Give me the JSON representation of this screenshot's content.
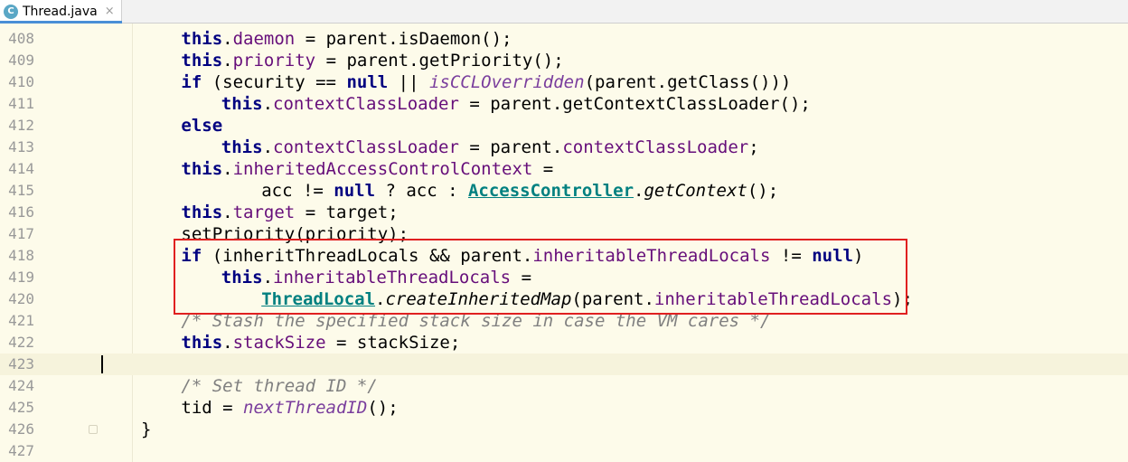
{
  "tab": {
    "icon_letter": "C",
    "title": "Thread.java",
    "close_glyph": "×"
  },
  "lines": [
    {
      "num": "408",
      "indent": 4,
      "tokens": [
        [
          "kw",
          "this"
        ],
        [
          "",
          "."
        ],
        [
          "fld",
          "daemon"
        ],
        [
          "",
          " = parent.isDaemon();"
        ]
      ]
    },
    {
      "num": "409",
      "indent": 4,
      "tokens": [
        [
          "kw",
          "this"
        ],
        [
          "",
          "."
        ],
        [
          "fld",
          "priority"
        ],
        [
          "",
          " = parent.getPriority();"
        ]
      ]
    },
    {
      "num": "410",
      "indent": 4,
      "tokens": [
        [
          "kw",
          "if"
        ],
        [
          "",
          " (security == "
        ],
        [
          "kw",
          "null"
        ],
        [
          "",
          " || "
        ],
        [
          "fn-static",
          "isCCLOverridden"
        ],
        [
          "",
          "(parent.getClass()))"
        ]
      ]
    },
    {
      "num": "411",
      "indent": 8,
      "tokens": [
        [
          "kw",
          "this"
        ],
        [
          "",
          "."
        ],
        [
          "fld",
          "contextClassLoader"
        ],
        [
          "",
          " = parent.getContextClassLoader();"
        ]
      ]
    },
    {
      "num": "412",
      "indent": 4,
      "tokens": [
        [
          "kw",
          "else"
        ]
      ]
    },
    {
      "num": "413",
      "indent": 8,
      "tokens": [
        [
          "kw",
          "this"
        ],
        [
          "",
          "."
        ],
        [
          "fld",
          "contextClassLoader"
        ],
        [
          "",
          " = parent."
        ],
        [
          "fld",
          "contextClassLoader"
        ],
        [
          "",
          ";"
        ]
      ]
    },
    {
      "num": "414",
      "indent": 4,
      "tokens": [
        [
          "kw",
          "this"
        ],
        [
          "",
          "."
        ],
        [
          "fld",
          "inheritedAccessControlContext"
        ],
        [
          "",
          " ="
        ]
      ]
    },
    {
      "num": "415",
      "indent": 12,
      "tokens": [
        [
          "",
          "acc != "
        ],
        [
          "kw",
          "null"
        ],
        [
          "",
          " ? acc : "
        ],
        [
          "cls",
          "AccessController"
        ],
        [
          "",
          "."
        ],
        [
          "mth-it",
          "getContext"
        ],
        [
          "",
          "();"
        ]
      ]
    },
    {
      "num": "416",
      "indent": 4,
      "tokens": [
        [
          "kw",
          "this"
        ],
        [
          "",
          "."
        ],
        [
          "fld",
          "target"
        ],
        [
          "",
          " = target;"
        ]
      ]
    },
    {
      "num": "417",
      "indent": 4,
      "tokens": [
        [
          "",
          "setPriority(priority);"
        ]
      ]
    },
    {
      "num": "418",
      "indent": 4,
      "tokens": [
        [
          "kw",
          "if"
        ],
        [
          "",
          " (inheritThreadLocals && parent."
        ],
        [
          "fld",
          "inheritableThreadLocals"
        ],
        [
          "",
          " != "
        ],
        [
          "kw",
          "null"
        ],
        [
          "",
          ")"
        ]
      ]
    },
    {
      "num": "419",
      "indent": 8,
      "tokens": [
        [
          "kw",
          "this"
        ],
        [
          "",
          "."
        ],
        [
          "fld",
          "inheritableThreadLocals"
        ],
        [
          "",
          " ="
        ]
      ]
    },
    {
      "num": "420",
      "indent": 12,
      "tokens": [
        [
          "cls",
          "ThreadLocal"
        ],
        [
          "",
          "."
        ],
        [
          "mth-it",
          "createInheritedMap"
        ],
        [
          "",
          "(parent."
        ],
        [
          "fld",
          "inheritableThreadLocals"
        ],
        [
          "",
          ");"
        ]
      ]
    },
    {
      "num": "421",
      "indent": 4,
      "tokens": [
        [
          "cmt",
          "/* Stash the specified stack size in case the VM cares */"
        ]
      ]
    },
    {
      "num": "422",
      "indent": 4,
      "tokens": [
        [
          "kw",
          "this"
        ],
        [
          "",
          "."
        ],
        [
          "fld",
          "stackSize"
        ],
        [
          "",
          " = stackSize;"
        ]
      ]
    },
    {
      "num": "423",
      "indent": 0,
      "tokens": [],
      "caret": true
    },
    {
      "num": "424",
      "indent": 4,
      "tokens": [
        [
          "cmt",
          "/* Set thread ID */"
        ]
      ]
    },
    {
      "num": "425",
      "indent": 4,
      "tokens": [
        [
          "",
          "tid = "
        ],
        [
          "fn-static",
          "nextThreadID"
        ],
        [
          "",
          "();"
        ]
      ]
    },
    {
      "num": "426",
      "indent": 0,
      "tokens": [
        [
          "",
          "}"
        ]
      ],
      "fold": true
    },
    {
      "num": "427",
      "indent": 0,
      "tokens": []
    }
  ]
}
